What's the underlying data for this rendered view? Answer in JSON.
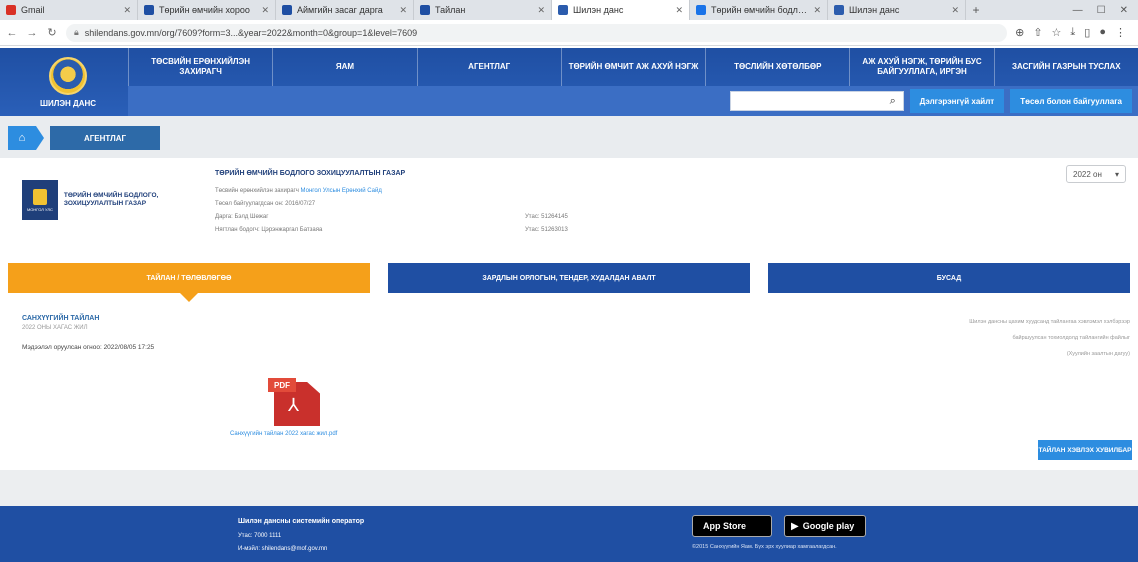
{
  "browser": {
    "tabs": [
      {
        "title": "Gmail",
        "favicon_color": "#d93025",
        "active": false
      },
      {
        "title": "Төрийн өмчийн хороо",
        "favicon_color": "#1f4fa3",
        "active": false
      },
      {
        "title": "Аймгийн засаг дарга",
        "favicon_color": "#1f4fa3",
        "active": false
      },
      {
        "title": "Тайлан",
        "favicon_color": "#1f4fa3",
        "active": false
      },
      {
        "title": "Шилэн данс",
        "favicon_color": "#2b5cad",
        "active": true
      },
      {
        "title": "Төрийн өмчийн бодлого",
        "favicon_color": "#1a73e8",
        "active": false
      },
      {
        "title": "Шилэн данс",
        "favicon_color": "#2b5cad",
        "active": false
      }
    ],
    "new_tab_icon": "+",
    "url": "shilendans.gov.mn/org/7609?form=3...&year=2022&month=0&group=1&level=7609"
  },
  "site": {
    "logo_text": "ШИЛЭН ДАНС",
    "nav": [
      "ТӨСВИЙН ЕРӨНХИЙЛЭН ЗАХИРАГЧ",
      "ЯАМ",
      "АГЕНТЛАГ",
      "ТӨРИЙН ӨМЧИТ АЖ АХУЙ НЭГЖ",
      "ТӨСЛИЙН ХӨТӨЛБӨР",
      "АЖ АХУЙ НЭГЖ, ТӨРИЙН БУС БАЙГУУЛЛАГА, ИРГЭН",
      "ЗАСГИЙН ГАЗРЫН ТУСЛАХ"
    ],
    "search_placeholder": "",
    "header_buttons": [
      "Дэлгэрэнгүй хайлт",
      "Төсөл болон байгууллага"
    ],
    "breadcrumb_current": "АГЕНТЛАГ"
  },
  "org": {
    "logo_name": "ТӨРИЙН ӨМЧИЙН БОДЛОГО, ЗОХИЦУУЛАЛТЫН ГАЗАР",
    "logo_badge_text": "МОНГОЛ УЛС",
    "title": "ТӨРИЙН ӨМЧИЙН БОДЛОГО ЗОХИЦУУЛАЛТЫН ГАЗАР",
    "rows": [
      {
        "label": "Төсвийн ерөнхийлэн захирагч",
        "value": "Монгол Улсын Ерөнхий Сайд",
        "value_is_link": true
      },
      {
        "label": "Төсөл байгуулагдсан он: 2016/07/27",
        "value": "",
        "value_is_link": false
      },
      {
        "label": "Дарга: Бэлд Шөжаг",
        "value": "Утас: 51264145",
        "value_is_link": false
      },
      {
        "label": "Нягтлан бодогч: Цэрэнжаргал Батзаяа",
        "value": "Утас: 51263013",
        "value_is_link": false
      }
    ],
    "year_selected": "2022 он"
  },
  "sections": [
    {
      "label": "ТАЙЛАН / ТӨЛӨВЛӨГӨӨ",
      "active": true
    },
    {
      "label": "ЗАРДЛЫН ОРЛОГЫН, ТЕНДЕР, ХУДАЛДАН АВАЛТ",
      "active": false
    },
    {
      "label": "БУСАД",
      "active": false
    }
  ],
  "report": {
    "title": "САНХҮҮГИЙН ТАЙЛАН",
    "subtitle": "2022 ОНЫ ХАГАС ЖИЛ",
    "date": "Мэдээлэл оруулсан огноо: 2022/08/05 17:25",
    "right_notes": [
      "Шилэн дансны цахим хуудсанд тайлангаа хэвлэмэл хэлбэрээр",
      "байршуулсан тохиолдолд тайлангийн файлыг",
      "(Хуулийн заалтын дагуу)"
    ],
    "pdf_label": "PDF",
    "pdf_filename": "Санхүүгийн тайлан 2022 хагас жил.pdf",
    "download_label": "ТАЙЛАН ХЭВЛЭХ ХУВИЛБАР"
  },
  "footer": {
    "title": "Шилэн дансны системийн оператор",
    "phone": "Утас: 7000 1111",
    "email": "И-мэйл: shilendans@mof.gov.mn",
    "app_store": "App Store",
    "google_play": "Google play",
    "copyright": "©2015 Санхүүгийн Яам. Бүх эрх хуулиар хамгаалагдсан."
  },
  "colors": {
    "header_blue": "#1f4fa3",
    "accent_blue": "#2d8de0",
    "orange_tab": "#f5a01a"
  }
}
